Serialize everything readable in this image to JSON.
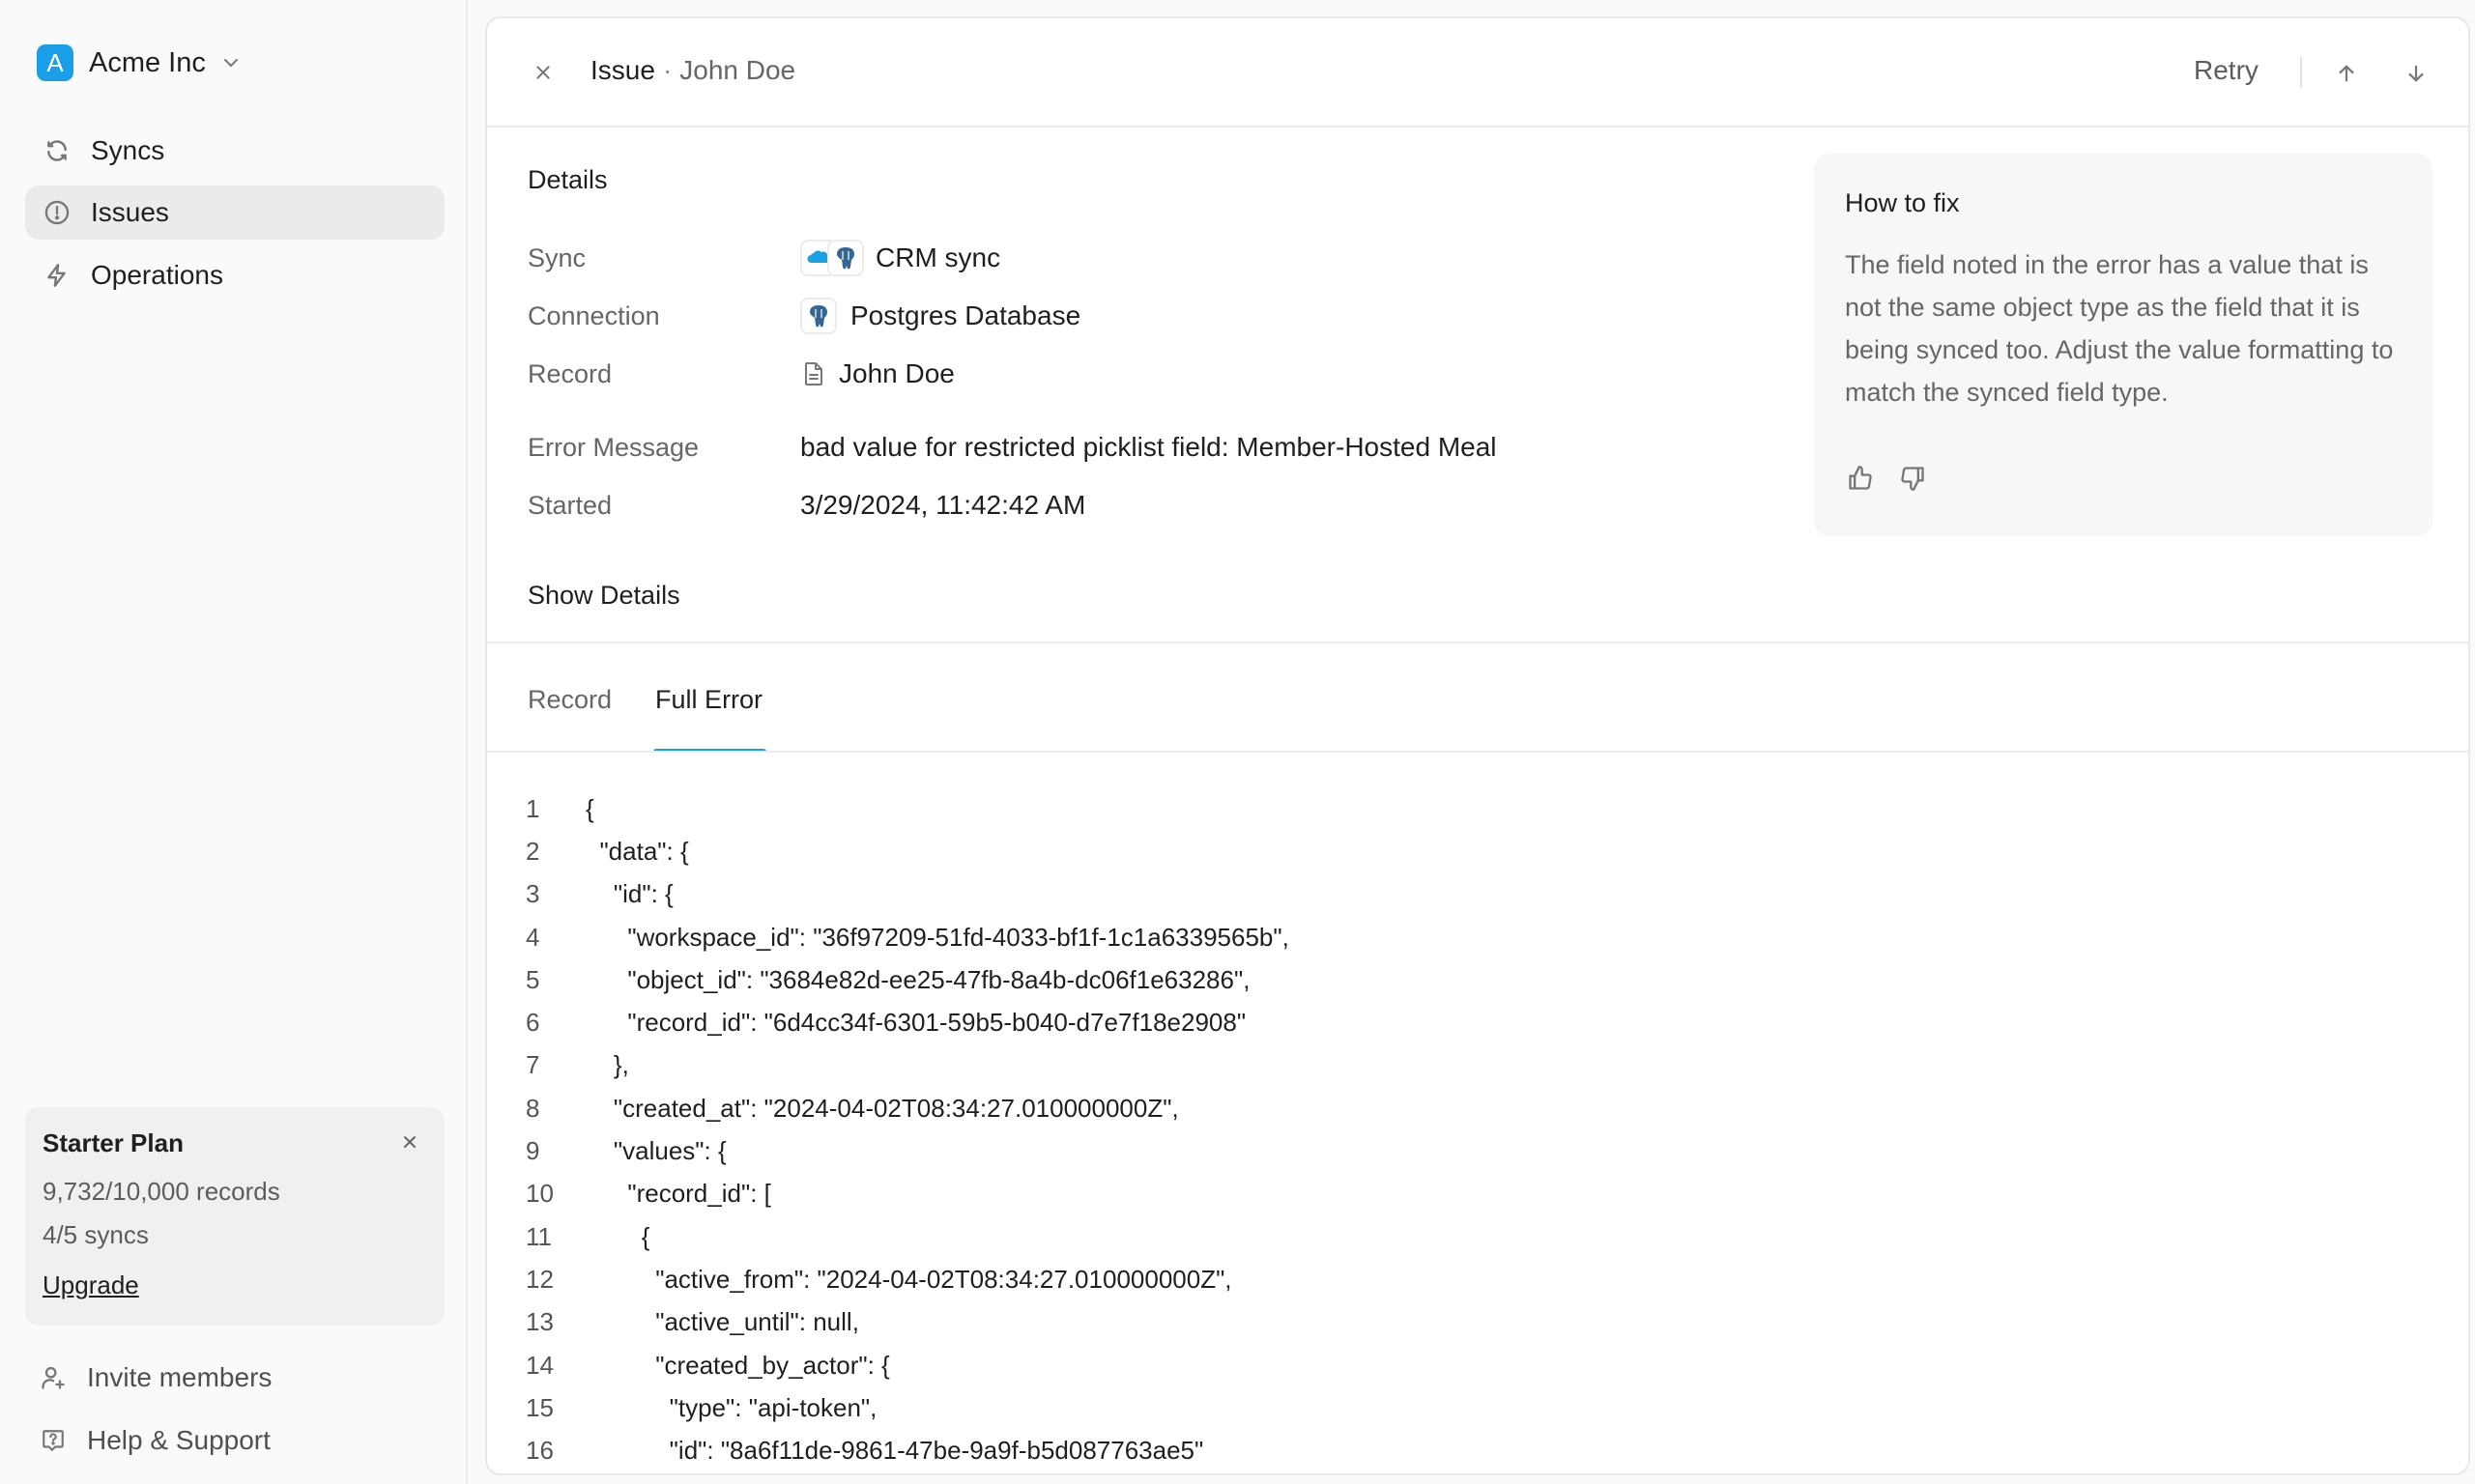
{
  "workspace": {
    "initial": "A",
    "name": "Acme Inc",
    "accent": "#1b9ee8"
  },
  "nav": [
    {
      "label": "Syncs",
      "icon": "refresh-icon",
      "active": false
    },
    {
      "label": "Issues",
      "icon": "alert-circle-icon",
      "active": true
    },
    {
      "label": "Operations",
      "icon": "lightning-icon",
      "active": false
    }
  ],
  "plan": {
    "title": "Starter Plan",
    "records": "9,732/10,000 records",
    "syncs": "4/5 syncs",
    "upgrade_label": "Upgrade"
  },
  "footer": {
    "invite_label": "Invite members",
    "help_label": "Help & Support"
  },
  "header": {
    "title": "Issue",
    "separator": "·",
    "subtitle": "John Doe",
    "retry_label": "Retry"
  },
  "details": {
    "title": "Details",
    "rows": [
      {
        "label": "Sync",
        "value": "CRM sync"
      },
      {
        "label": "Connection",
        "value": "Postgres Database"
      },
      {
        "label": "Record",
        "value": "John Doe"
      },
      {
        "label": "Error Message",
        "value": "bad value for restricted picklist field: Member-Hosted Meal"
      },
      {
        "label": "Started",
        "value": "3/29/2024, 11:42:42 AM"
      }
    ],
    "show_details_label": "Show Details"
  },
  "how_to_fix": {
    "title": "How to fix",
    "body": "The field noted in the error has a value that is not the same object type as the field that it is being synced too. Adjust the value formatting to match the synced field type."
  },
  "tabs": [
    {
      "label": "Record",
      "active": false
    },
    {
      "label": "Full Error",
      "active": true
    }
  ],
  "code_lines": [
    {
      "n": "1",
      "text": "{"
    },
    {
      "n": "2",
      "text": "  \"data\": {"
    },
    {
      "n": "3",
      "text": "    \"id\": {"
    },
    {
      "n": "4",
      "text": "      \"workspace_id\": \"36f97209-51fd-4033-bf1f-1c1a6339565b\","
    },
    {
      "n": "5",
      "text": "      \"object_id\": \"3684e82d-ee25-47fb-8a4b-dc06f1e63286\","
    },
    {
      "n": "6",
      "text": "      \"record_id\": \"6d4cc34f-6301-59b5-b040-d7e7f18e2908\""
    },
    {
      "n": "7",
      "text": "    },"
    },
    {
      "n": "8",
      "text": "    \"created_at\": \"2024-04-02T08:34:27.010000000Z\","
    },
    {
      "n": "9",
      "text": "    \"values\": {"
    },
    {
      "n": "10",
      "text": "      \"record_id\": ["
    },
    {
      "n": "11",
      "text": "        {"
    },
    {
      "n": "12",
      "text": "          \"active_from\": \"2024-04-02T08:34:27.010000000Z\","
    },
    {
      "n": "13",
      "text": "          \"active_until\": null,"
    },
    {
      "n": "14",
      "text": "          \"created_by_actor\": {"
    },
    {
      "n": "15",
      "text": "            \"type\": \"api-token\","
    },
    {
      "n": "16",
      "text": "            \"id\": \"8a6f11de-9861-47be-9a9f-b5d087763ae5\""
    }
  ]
}
